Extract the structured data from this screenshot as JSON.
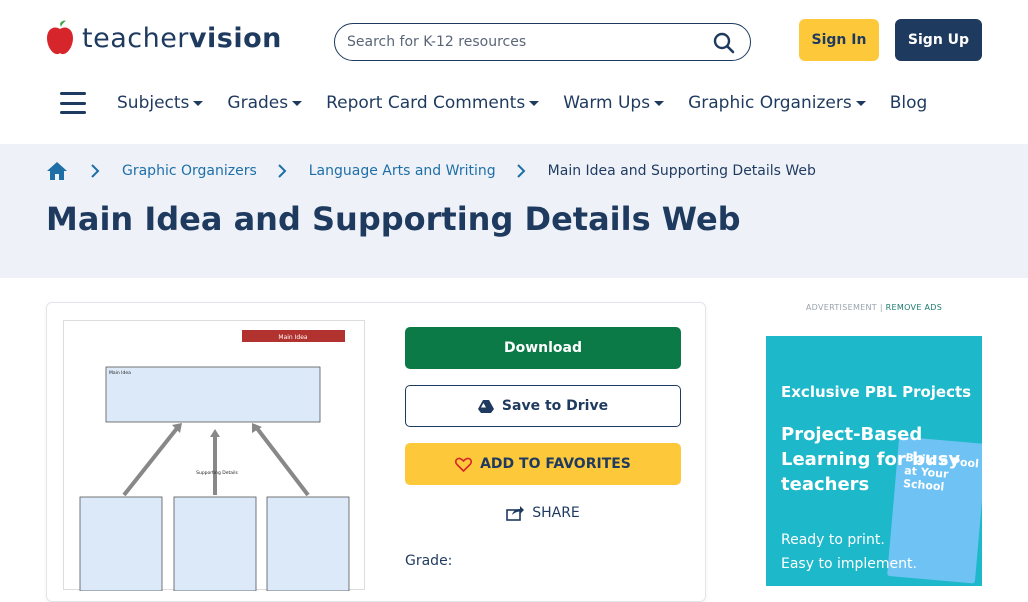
{
  "header": {
    "logo_text_light": "teacher",
    "logo_text_bold": "vision",
    "search_placeholder": "Search for K-12 resources",
    "signin_label": "Sign In",
    "signup_label": "Sign Up"
  },
  "nav": {
    "items": [
      {
        "label": "Subjects",
        "dropdown": true
      },
      {
        "label": "Grades",
        "dropdown": true
      },
      {
        "label": "Report Card Comments",
        "dropdown": true
      },
      {
        "label": "Warm Ups",
        "dropdown": true
      },
      {
        "label": "Graphic Organizers",
        "dropdown": true
      },
      {
        "label": "Blog",
        "dropdown": false
      }
    ]
  },
  "breadcrumb": {
    "items": [
      "Graphic Organizers",
      "Language Arts and Writing"
    ],
    "current": "Main Idea and Supporting Details Web"
  },
  "page": {
    "title": "Main Idea and Supporting Details Web"
  },
  "actions": {
    "download": "Download",
    "save_drive": "Save to Drive",
    "favorites": "ADD TO FAVORITES",
    "share": "SHARE",
    "grade_label": "Grade:"
  },
  "thumbnail": {
    "header_label": "Main Idea",
    "box_label": "Main Idea",
    "center_label": "Supporting Details"
  },
  "ad": {
    "label": "ADVERTISEMENT |",
    "remove": "REMOVE ADS",
    "heading": "Exclusive PBL Projects",
    "title": "Project-Based Learning for busy teachers",
    "line1": "Ready to print.",
    "line2": "Easy to implement.",
    "book_title": "Build a Pool at Your School"
  },
  "colors": {
    "navy": "#1f3a5f",
    "yellow": "#fdc93a",
    "green": "#0b7a46",
    "teal": "#1db8c9",
    "link": "#1e6fa8"
  }
}
